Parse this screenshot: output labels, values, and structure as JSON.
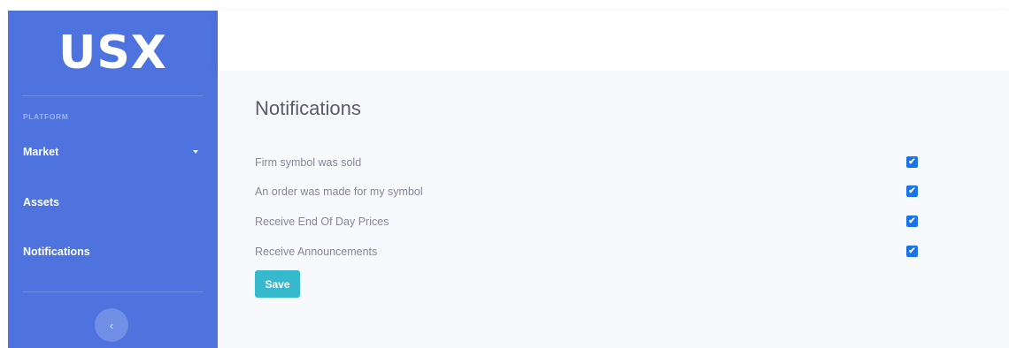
{
  "brand": {
    "name": "USX"
  },
  "sidebar": {
    "heading": "PLATFORM",
    "items": [
      {
        "label": "Market",
        "has_dropdown": true
      },
      {
        "label": "Assets"
      },
      {
        "label": "Notifications"
      }
    ],
    "toggle_glyph": "‹"
  },
  "page": {
    "title": "Notifications",
    "settings": [
      {
        "label": "Firm symbol was sold",
        "checked": true
      },
      {
        "label": "An order was made for my symbol",
        "checked": true
      },
      {
        "label": "Receive End Of Day Prices",
        "checked": true
      },
      {
        "label": "Receive Announcements",
        "checked": true
      }
    ],
    "checkbox_glyph": "✔",
    "save_label": "Save"
  },
  "colors": {
    "sidebar": "#4e73df",
    "save_button": "#36b9cc",
    "checkbox": "#1a73e8",
    "content_bg": "#f8f9fc"
  },
  "icons": {
    "dropdown": "caret-down-icon",
    "toggle": "chevron-left-icon",
    "checkbox": "checkmark-icon"
  }
}
